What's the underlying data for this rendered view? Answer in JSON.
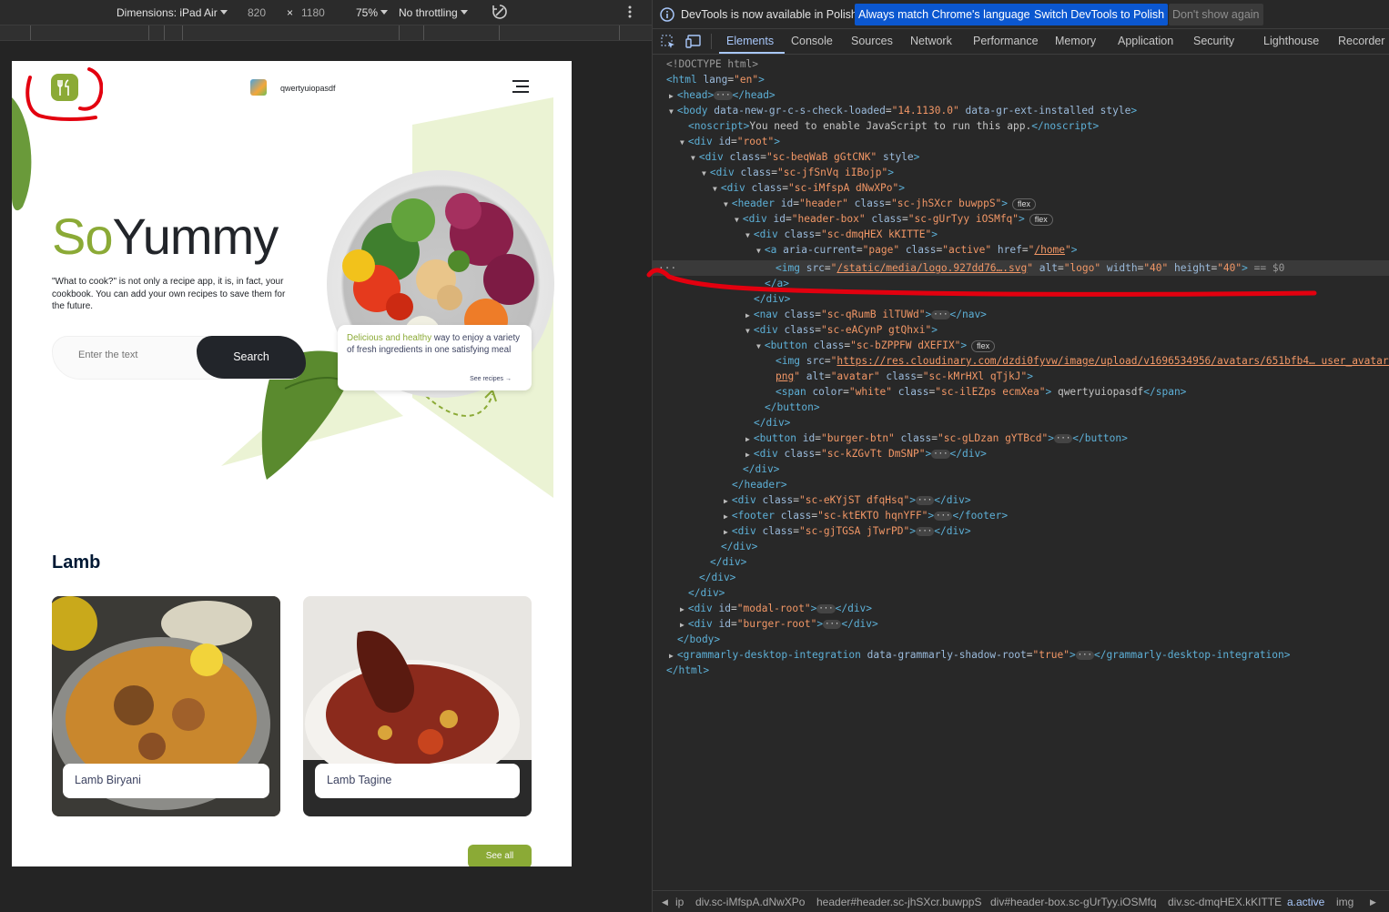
{
  "device_toolbar": {
    "dimensions_label": "Dimensions: iPad Air",
    "width": "820",
    "times": "×",
    "height": "1180",
    "zoom": "75%",
    "throttling": "No throttling"
  },
  "app": {
    "username": "qwertyuiopasdf",
    "hero": {
      "title_accent": "So",
      "title_rest": "Yummy",
      "description": "\"What to cook?\" is not only a recipe app, it is, in fact, your cookbook. You can add your own recipes to save them for the future.",
      "search_placeholder": "Enter the text",
      "search_button": "Search",
      "promo_accent": "Delicious and healthy",
      "promo_rest": " way to enjoy a variety of fresh ingredients in one satisfying meal",
      "promo_link": "See recipes"
    },
    "section_title": "Lamb",
    "cards": [
      {
        "title": "Lamb Biryani"
      },
      {
        "title": "Lamb Tagine"
      }
    ],
    "see_all": "See all"
  },
  "devtools": {
    "info_text": "DevTools is now available in Polish!",
    "btn_match": "Always match Chrome's language",
    "btn_switch": "Switch DevTools to Polish",
    "btn_dismiss": "Don't show again",
    "tabs": [
      "Elements",
      "Console",
      "Sources",
      "Network",
      "Performance",
      "Memory",
      "Application",
      "Security",
      "Lighthouse",
      "Recorder"
    ],
    "active_tab": "Elements",
    "breadcrumbs": [
      "ip",
      "div.sc-iMfspA.dNwXPo",
      "header#header.sc-jhSXcr.buwppS",
      "div#header-box.sc-gUrTyy.iOSMfq",
      "div.sc-dmqHEX.kKITTE",
      "a.active",
      "img"
    ]
  },
  "colors": {
    "accent": "#8baa36",
    "dark": "#22252a",
    "annotation": "#e3000f"
  }
}
